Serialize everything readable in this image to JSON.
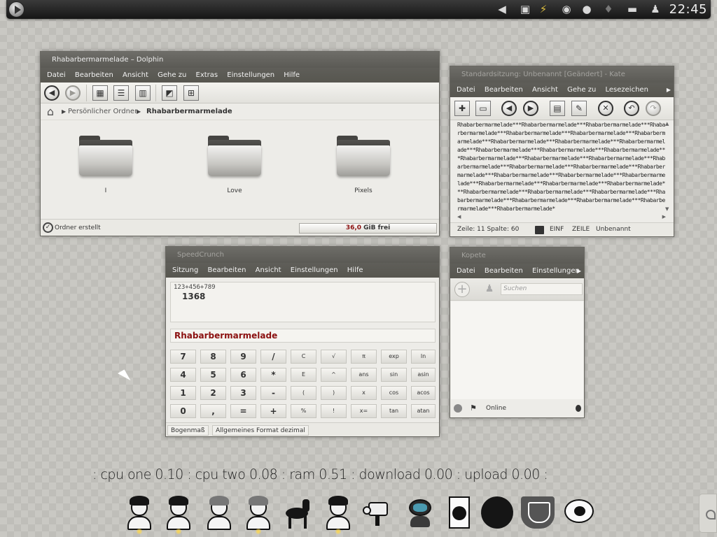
{
  "top_panel": {
    "clock": "22:45",
    "tray_icons": [
      "back-arrow-icon",
      "display-icon",
      "battery-icon",
      "network-icon",
      "power-icon",
      "bulb-icon",
      "keyboard-icon",
      "person-icon"
    ]
  },
  "dolphin": {
    "title": "Rhabarbermarmelade – Dolphin",
    "menu": [
      "Datei",
      "Bearbeiten",
      "Ansicht",
      "Gehe zu",
      "Extras",
      "Einstellungen",
      "Hilfe"
    ],
    "breadcrumb": [
      "Persönlicher Ordner",
      "Rhabarbermarmelade"
    ],
    "folders": [
      "I",
      "Love",
      "Pixels"
    ],
    "status_text": "Ordner erstellt",
    "free_space_value": "36,0",
    "free_space_suffix": " GiB frei"
  },
  "kate": {
    "title": "Standardsitzung: Unbenannt [Geändert] - Kate",
    "menu": [
      "Datei",
      "Bearbeiten",
      "Ansicht",
      "Gehe zu",
      "Lesezeichen"
    ],
    "text": "Rhabarbermarmelade***Rhabarbermarmelade***Rhabarbermarmelade***Rhabarbermarmelade***Rhabarbermarmelade***Rhabarbermarmelade***Rhabarbermarmelade***Rhabarbermarmelade***Rhabarbermarmelade***Rhabarbermarmelade***Rhabarbermarmelade***Rhabarbermarmelade***Rhabarbermarmelade***Rhabarbermarmelade***Rhabarbermarmelade***Rhabarbermarmelade***Rhabarbermarmelade***Rhabarbermarmelade***Rhabarbermarmelade***Rhabarbermarmelade***Rhabarbermarmelade***Rhabarbermarmelade***Rhabarbermarmelade***Rhabarbermarmelade***Rhabarbermarmelade***Rhabarbermarmelade***Rhabarbermarmelade***Rhabarbermarmelade***Rhabarbermarmelade***Rhabarbermarmelade***Rhabarbermarmelade***Rhabarbermarmelade***Rhabarbermarmelade***Rhabarbermarmelade*",
    "status_position": "Zeile: 11 Spalte: 60",
    "status_mode": "EINF",
    "status_select": "ZEILE",
    "status_doc": "Unbenannt"
  },
  "speedcrunch": {
    "title": "SpeedCrunch",
    "menu": [
      "Sitzung",
      "Bearbeiten",
      "Ansicht",
      "Einstellungen",
      "Hilfe"
    ],
    "history_expression": "123+456+789",
    "history_result": "1368",
    "input": "Rhabarbermarmelade",
    "keys": [
      [
        "7",
        "8",
        "9",
        "/",
        "C",
        "√",
        "π",
        "exp",
        "ln"
      ],
      [
        "4",
        "5",
        "6",
        "*",
        "E",
        "^",
        "ans",
        "sin",
        "asin"
      ],
      [
        "1",
        "2",
        "3",
        "-",
        "(",
        ")",
        "x",
        "cos",
        "acos"
      ],
      [
        "0",
        ",",
        "=",
        "+",
        "%",
        "!",
        "x=",
        "tan",
        "atan"
      ]
    ],
    "status_angle": "Bogenmaß",
    "status_format": "Allgemeines Format dezimal"
  },
  "kopete": {
    "title": "Kopete",
    "menu": [
      "Datei",
      "Bearbeiten",
      "Einstellungen"
    ],
    "search_placeholder": "Suchen",
    "status": "Online"
  },
  "sysmon": {
    "text": ": cpu one  0.10  :  cpu two  0.08  :  ram  0.51  :  download  0.00  :  upload  0.00  :"
  }
}
